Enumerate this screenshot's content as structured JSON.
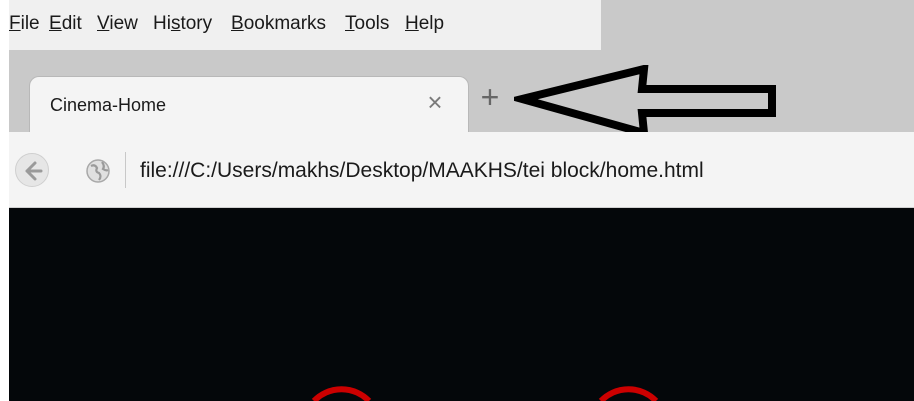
{
  "menubar": {
    "items": [
      {
        "pre": "",
        "acc": "F",
        "post": "ile"
      },
      {
        "pre": "",
        "acc": "E",
        "post": "dit"
      },
      {
        "pre": "",
        "acc": "V",
        "post": "iew"
      },
      {
        "pre": "Hi",
        "acc": "s",
        "post": "tory"
      },
      {
        "pre": "",
        "acc": "B",
        "post": "ookmarks"
      },
      {
        "pre": "",
        "acc": "T",
        "post": "ools"
      },
      {
        "pre": "",
        "acc": "H",
        "post": "elp"
      }
    ]
  },
  "tabs": {
    "active_title": "Cinema-Home",
    "close_glyph": "×",
    "new_tab_glyph": "+"
  },
  "navbar": {
    "url": "file:///C:/Users/makhs/Desktop/MAAKHS/tei block/home.html"
  },
  "colors": {
    "chrome": "#c9c9c9",
    "tab": "#f4f4f4",
    "content": "#04070a",
    "accent_red": "#cc0000"
  }
}
